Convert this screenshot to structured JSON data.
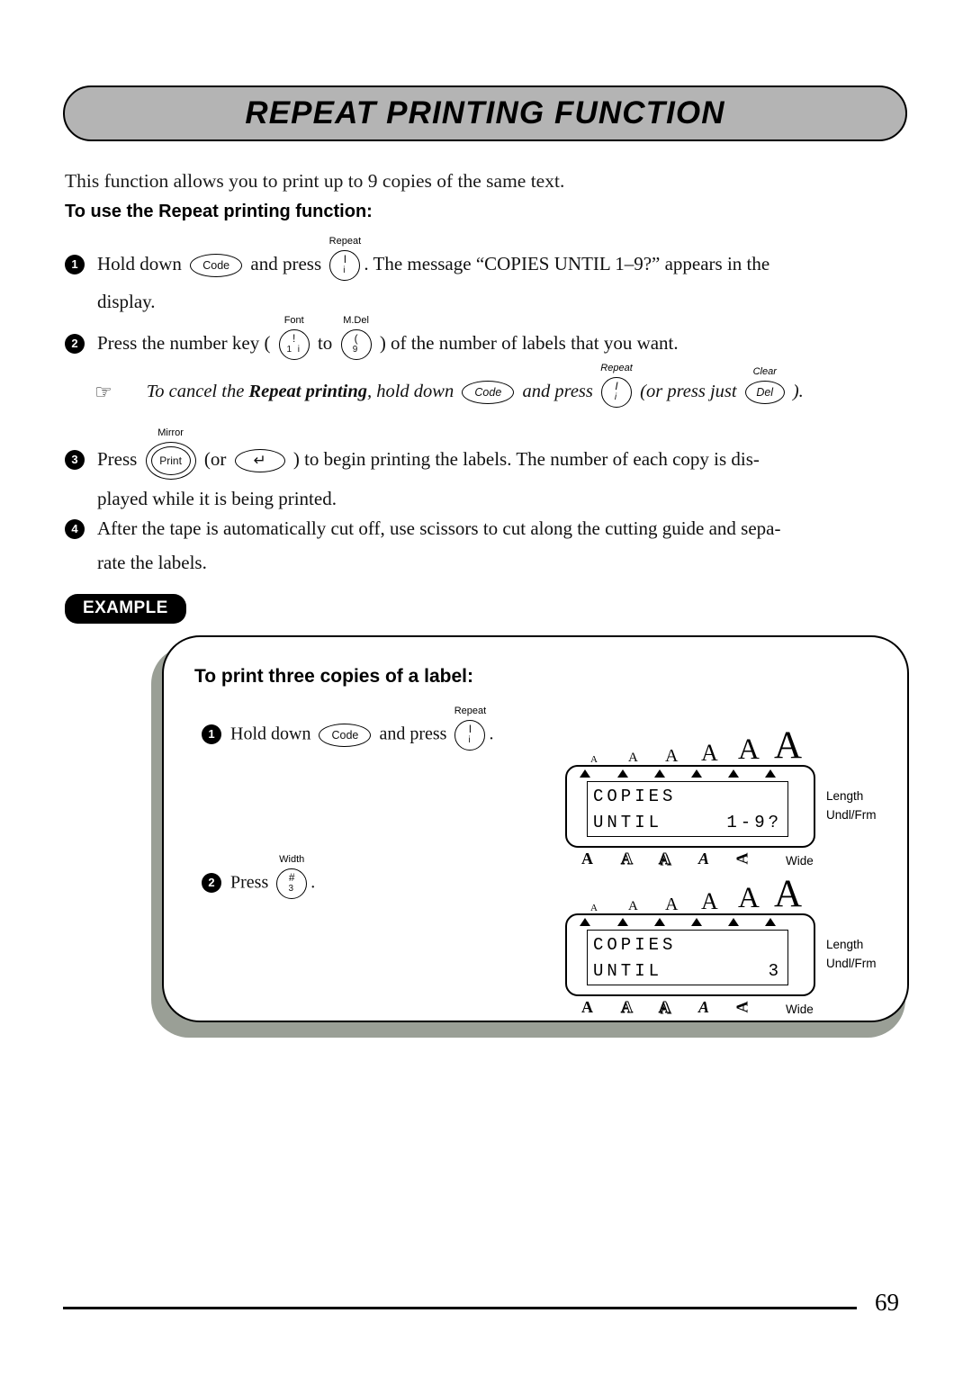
{
  "page": {
    "title": "REPEAT PRINTING FUNCTION",
    "page_number": "69",
    "intro": "This function allows you to print up to 9 copies of the same text.",
    "subheading": "To use the Repeat printing function:"
  },
  "keys": {
    "code": {
      "label": "Code",
      "top": ""
    },
    "repeat": {
      "upper": "I",
      "lower": "i",
      "top": "Repeat"
    },
    "font": {
      "upper": "!",
      "lower": "1 i",
      "top": "Font"
    },
    "mdel": {
      "upper": "(",
      "lower": "9",
      "top": "M.Del"
    },
    "del": {
      "label": "Del",
      "top": "Clear"
    },
    "print": {
      "label": "Print",
      "top": "Mirror"
    },
    "enter": {
      "label": "↵",
      "top": ""
    },
    "width3": {
      "upper": "#",
      "lower": "3",
      "top": "Width"
    }
  },
  "steps": [
    {
      "num": "1",
      "parts": [
        {
          "t": "text",
          "v": "Hold down "
        },
        {
          "t": "key",
          "v": "code"
        },
        {
          "t": "text",
          "v": " and press "
        },
        {
          "t": "key",
          "v": "repeat"
        },
        {
          "t": "text",
          "v": ". The message “COPIES UNTIL 1–9?” appears in the"
        }
      ],
      "continuation": "display."
    },
    {
      "num": "2",
      "parts": [
        {
          "t": "text",
          "v": "Press the number key ( "
        },
        {
          "t": "key",
          "v": "font"
        },
        {
          "t": "text",
          "v": " to "
        },
        {
          "t": "key",
          "v": "mdel"
        },
        {
          "t": "text",
          "v": " ) of the number of labels that you want."
        }
      ],
      "continuation": ""
    },
    {
      "num": "3",
      "parts": [
        {
          "t": "text",
          "v": "Press "
        },
        {
          "t": "key",
          "v": "print"
        },
        {
          "t": "text",
          "v": " (or "
        },
        {
          "t": "key",
          "v": "enter"
        },
        {
          "t": "text",
          "v": " ) to begin printing the labels. The number of each copy is dis-"
        }
      ],
      "continuation": "played while it is being printed."
    },
    {
      "num": "4",
      "parts": [
        {
          "t": "text",
          "v": "After the tape is automatically cut off, use scissors to cut along the cutting guide and sepa-"
        }
      ],
      "continuation": "rate the labels."
    }
  ],
  "note": {
    "icon": "pointing-hand",
    "icon_glyph": "☞",
    "pre": "To cancel the ",
    "bold": "Repeat printing",
    "mid": ", hold down ",
    "after_code": " and press ",
    "after_repeat": " (or press just ",
    "tail": " )."
  },
  "example": {
    "badge": "EXAMPLE",
    "title": "To print three copies of a label:",
    "steps": [
      {
        "num": "1",
        "pre": "Hold down ",
        "mid": " and press ",
        "post": ".",
        "key_a": "code",
        "key_b": "repeat"
      },
      {
        "num": "2",
        "pre": "Press ",
        "mid": "",
        "post": ".",
        "key_a": "width3",
        "key_b": ""
      }
    ],
    "displays": [
      {
        "line1": "COPIES",
        "line2_left": "UNTIL",
        "line2_right": "1-9?",
        "right_labels": [
          "Length",
          "Undl/Frm"
        ],
        "bottom_labels": [
          "A",
          "A",
          "A",
          "A",
          "A",
          "Wide"
        ],
        "size_indicators": [
          "A",
          "A",
          "A",
          "A",
          "A",
          "A"
        ]
      },
      {
        "line1": "COPIES",
        "line2_left": "UNTIL",
        "line2_right": "3",
        "right_labels": [
          "Length",
          "Undl/Frm"
        ],
        "bottom_labels": [
          "A",
          "A",
          "A",
          "A",
          "A",
          "Wide"
        ],
        "size_indicators": [
          "A",
          "A",
          "A",
          "A",
          "A",
          "A"
        ]
      }
    ]
  },
  "colors": {
    "banner_fill": "#b4b4b4",
    "banner_border": "#000000",
    "badge_fill": "#000000",
    "example_shadow": "#9a9f96",
    "text": "#000000"
  }
}
